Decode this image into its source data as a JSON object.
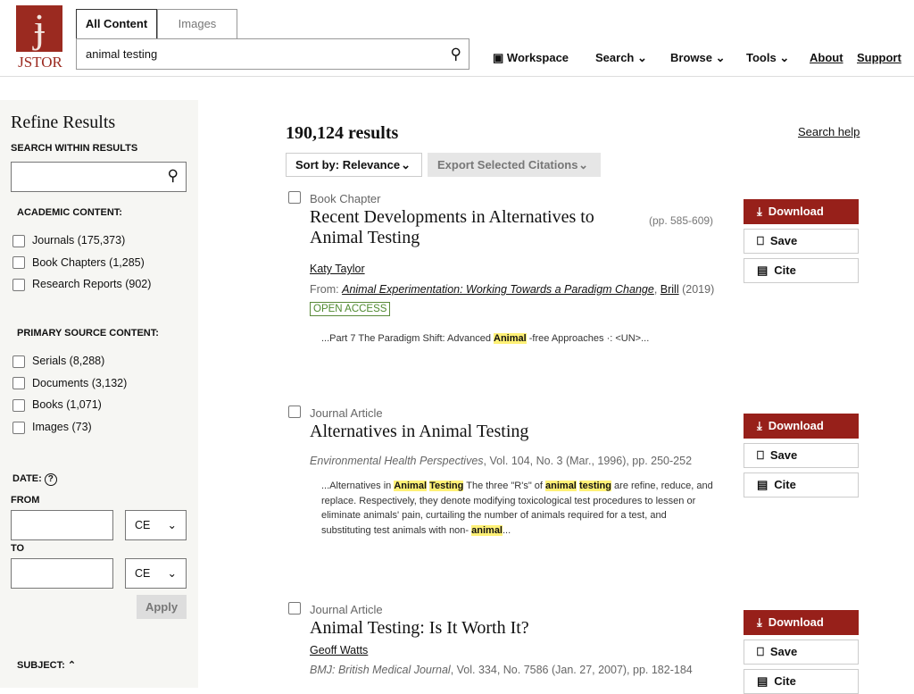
{
  "header": {
    "logo_text": "JSTOR",
    "tabs": [
      "All Content",
      "Images"
    ],
    "search_value": "animal testing",
    "nav": [
      "Workspace",
      "Search",
      "Browse",
      "Tools",
      "About",
      "Support"
    ]
  },
  "sidebar": {
    "title": "Refine Results",
    "search_within_label": "SEARCH WITHIN RESULTS",
    "search_within_value": "",
    "academic_label": "ACADEMIC CONTENT:",
    "academic": [
      "Journals (175,373)",
      "Book Chapters (1,285)",
      "Research Reports (902)"
    ],
    "primary_label": "PRIMARY SOURCE CONTENT:",
    "primary": [
      "Serials (8,288)",
      "Documents (3,132)",
      "Books (1,071)",
      "Images (73)"
    ],
    "date_label": "DATE:",
    "from_label": "FROM",
    "to_label": "TO",
    "era": "CE",
    "apply": "Apply",
    "subject_label": "SUBJECT:"
  },
  "main": {
    "count": "190,124 results",
    "search_help": "Search help",
    "sort": "Sort by: Relevance",
    "export": "Export Selected Citations",
    "actions": {
      "download": "Download",
      "save": "Save",
      "cite": "Cite"
    },
    "results": [
      {
        "type": "Book Chapter",
        "title": "Recent Developments in Alternatives to Animal Testing",
        "pages": "(pp. 585-609)",
        "author": "Katy Taylor",
        "from_label": "From: ",
        "from_title": "Animal Experimentation: Working Towards a Paradigm Change",
        "publisher": "Brill",
        "year": "(2019)",
        "badge": "OPEN ACCESS",
        "snippet": [
          {
            "t": "...Part 7 The Paradigm Shift: Advanced "
          },
          {
            "t": "Animal",
            "hl": true
          },
          {
            "t": " -free Approaches ·: <UN>..."
          }
        ]
      },
      {
        "type": "Journal Article",
        "title": "Alternatives in Animal Testing",
        "journal": "Environmental Health Perspectives",
        "citation": ", Vol. 104, No. 3 (Mar., 1996), pp. 250-252",
        "snippet": [
          {
            "t": "...Alternatives in "
          },
          {
            "t": "Animal",
            "hl": true
          },
          {
            "t": " "
          },
          {
            "t": "Testing",
            "hl": true
          },
          {
            "t": " The three \"R's\" of "
          },
          {
            "t": "animal",
            "hl": true
          },
          {
            "t": " "
          },
          {
            "t": "testing",
            "hl": true
          },
          {
            "t": " are refine, reduce, and replace. Respectively, they denote modifying toxicological test procedures to lessen or eliminate animals' pain, curtailing the number of animals required for a test, and substituting test animals with non- "
          },
          {
            "t": "animal",
            "hl": true
          },
          {
            "t": "..."
          }
        ]
      },
      {
        "type": "Journal Article",
        "title": "Animal Testing: Is It Worth It?",
        "author": "Geoff Watts",
        "journal": "BMJ: British Medical Journal",
        "citation": ", Vol. 334, No. 7586 (Jan. 27, 2007), pp. 182-184"
      }
    ]
  }
}
